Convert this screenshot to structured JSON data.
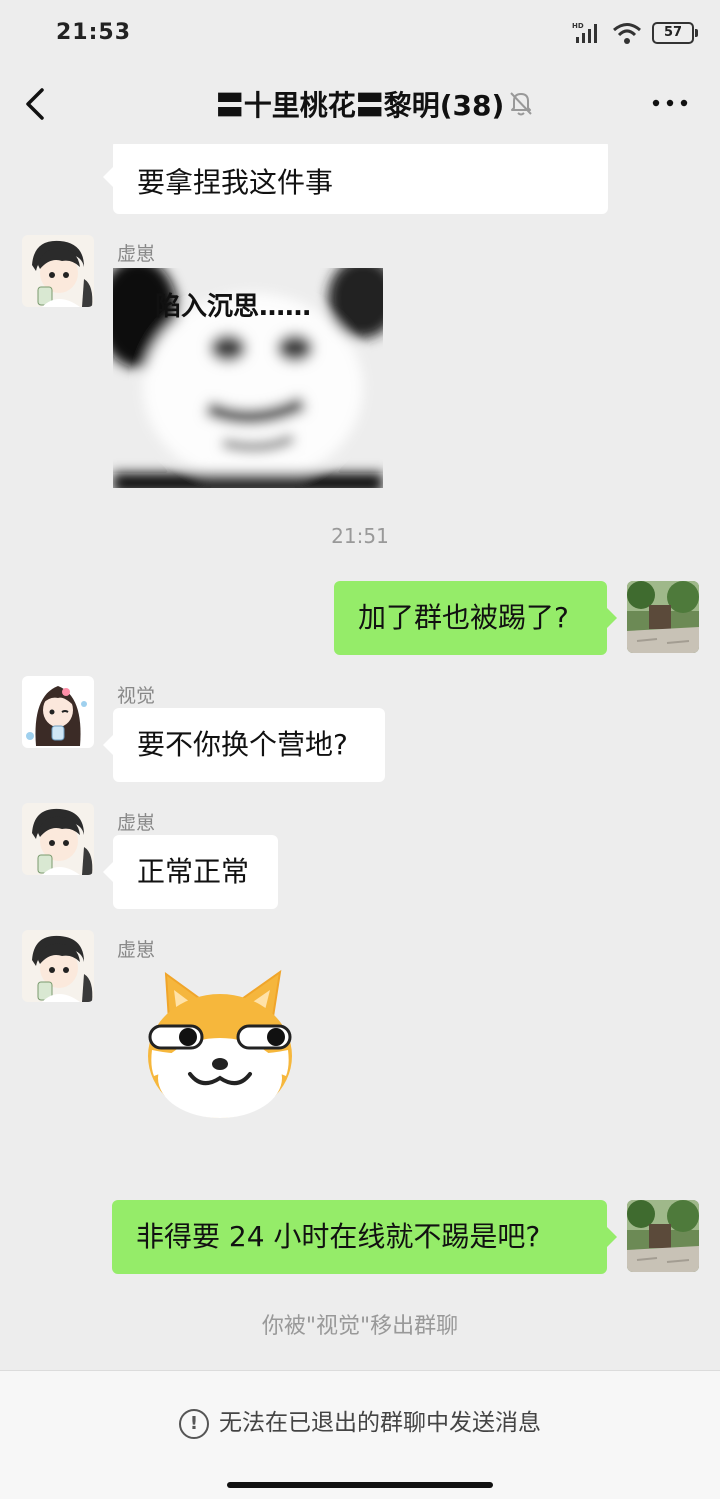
{
  "status_bar": {
    "time": "21:53",
    "network": "HD",
    "battery": "57"
  },
  "header": {
    "title": "〓十里桃花〓黎明(38)"
  },
  "messages": {
    "m0": {
      "text": "要拿捏我这件事"
    },
    "m1": {
      "sender": "虚崽",
      "meme_caption": "陷入沉思……"
    },
    "timestamp": "21:51",
    "m2": {
      "text": "加了群也被踢了?"
    },
    "m3": {
      "sender": "视觉",
      "text": "要不你换个营地?"
    },
    "m4": {
      "sender": "虚崽",
      "text": "正常正常"
    },
    "m5": {
      "sender": "虚崽"
    },
    "m6": {
      "text": "非得要 24 小时在线就不踢是吧?"
    },
    "system": "你被\"视觉\"移出群聊"
  },
  "footer": {
    "notice": "无法在已退出的群聊中发送消息"
  },
  "icons": [
    "back-icon",
    "mute-icon",
    "more-icon",
    "info-icon",
    "signal-icon",
    "wifi-icon",
    "battery-icon"
  ],
  "colors": {
    "outgoing_bubble": "#95ec69",
    "incoming_bubble": "#ffffff",
    "background": "#ededed"
  }
}
